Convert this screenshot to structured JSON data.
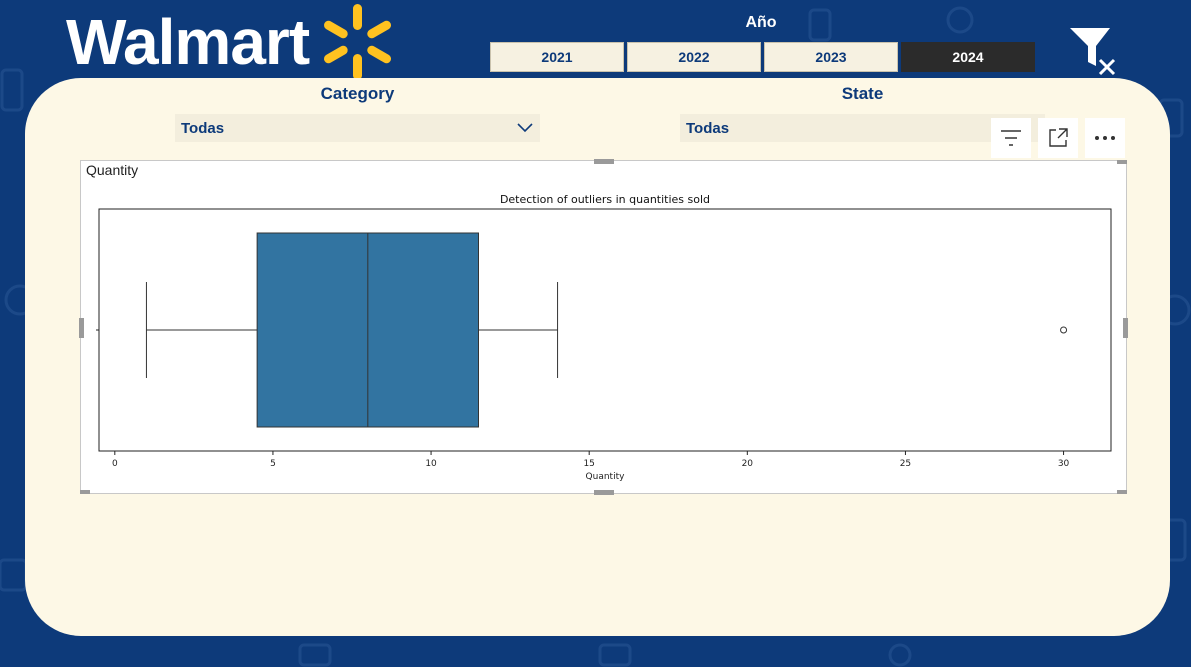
{
  "brand": {
    "name": "Walmart",
    "spark_color": "#ffc220"
  },
  "colors": {
    "background": "#0d3a7a",
    "panel": "#fdf8e6",
    "accent": "#0d3a7a",
    "box": "#3274a1"
  },
  "year_filter": {
    "label": "Año",
    "options": [
      "2021",
      "2022",
      "2023",
      "2024"
    ],
    "selected": "2024"
  },
  "clear_filters_icon": "filter-clear-icon",
  "slicers": {
    "category": {
      "title": "Category",
      "value": "Todas"
    },
    "state": {
      "title": "State",
      "value": "Todas"
    }
  },
  "visual_header_icons": [
    "filter-icon",
    "focus-mode-icon",
    "more-options-icon"
  ],
  "visual": {
    "title": "Quantity"
  },
  "chart_data": {
    "type": "boxplot",
    "title": "Detection of outliers in quantities sold",
    "xlabel": "Quantity",
    "ylabel": "",
    "xlim": [
      -0.5,
      31.5
    ],
    "xticks": [
      0,
      5,
      10,
      15,
      20,
      25,
      30
    ],
    "orientation": "horizontal",
    "whisker_low": 1,
    "q1": 4.5,
    "median": 8,
    "q3": 11.5,
    "whisker_high": 14,
    "outliers": [
      30
    ],
    "grid": false
  }
}
